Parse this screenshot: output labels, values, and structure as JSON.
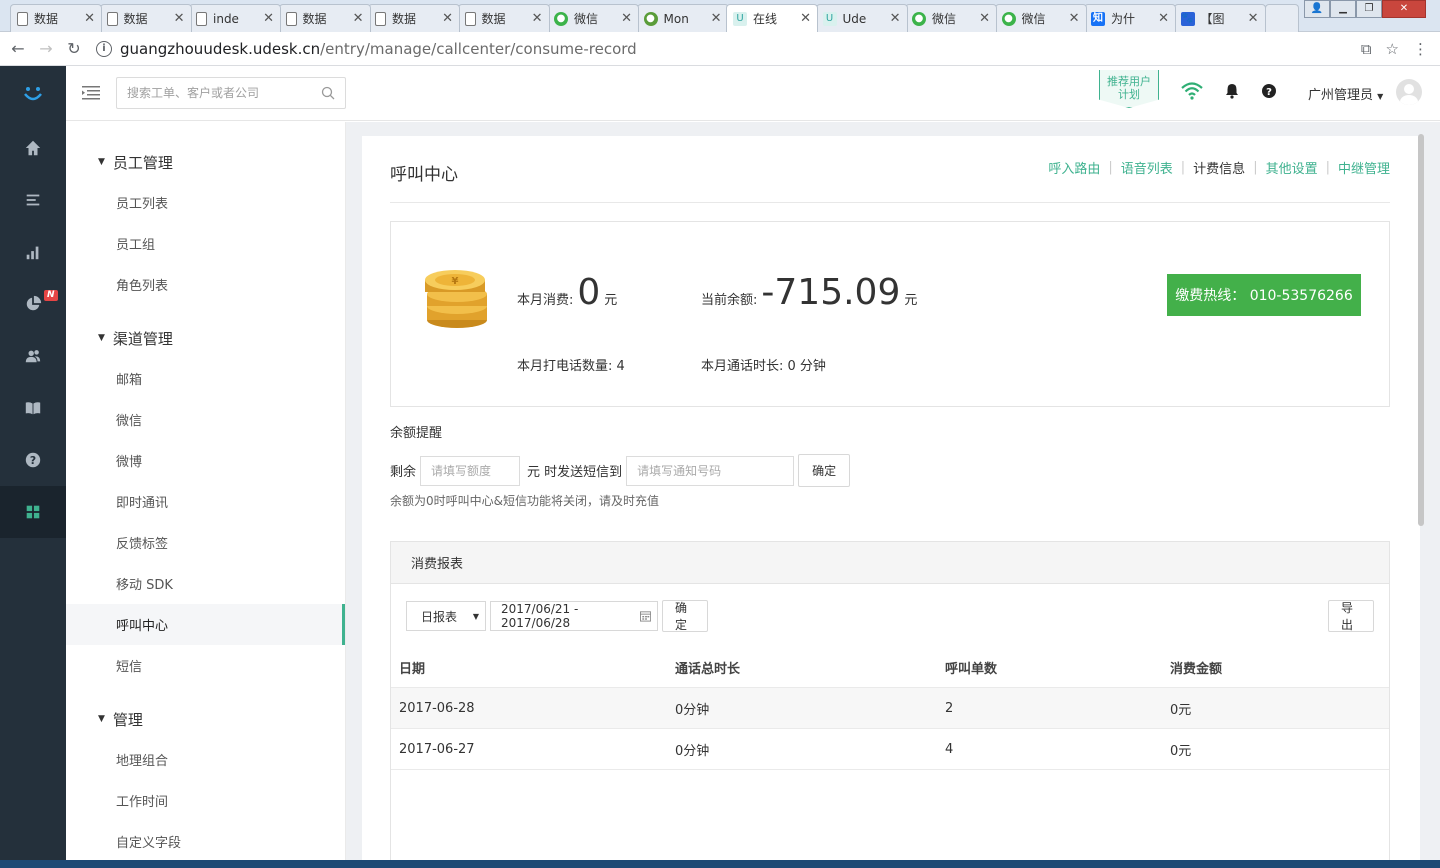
{
  "browser": {
    "tabs": [
      {
        "title": "数据",
        "icon": "doc"
      },
      {
        "title": "数据",
        "icon": "doc"
      },
      {
        "title": "inde",
        "icon": "doc"
      },
      {
        "title": "数据",
        "icon": "doc"
      },
      {
        "title": "数据",
        "icon": "doc"
      },
      {
        "title": "数据",
        "icon": "doc"
      },
      {
        "title": "微信",
        "icon": "wechat"
      },
      {
        "title": "Mon",
        "icon": "mon"
      },
      {
        "title": "在线",
        "icon": "udesk",
        "active": true
      },
      {
        "title": "Ude",
        "icon": "udesk"
      },
      {
        "title": "微信",
        "icon": "wechat"
      },
      {
        "title": "微信",
        "icon": "wechat"
      },
      {
        "title": "为什",
        "icon": "zhihu"
      },
      {
        "title": "【图",
        "icon": "baidu"
      }
    ],
    "url_host": "guangzhouudesk.udesk.cn",
    "url_path": "/entry/manage/callcenter/consume-record"
  },
  "topbar": {
    "search_placeholder": "搜索工单、客户或者公司",
    "recommend_line1": "推荐用户",
    "recommend_line2": "计划",
    "user_name": "广州管理员"
  },
  "sidebar": {
    "groups": [
      {
        "title": "员工管理",
        "items": [
          "员工列表",
          "员工组",
          "角色列表"
        ]
      },
      {
        "title": "渠道管理",
        "items": [
          "邮箱",
          "微信",
          "微博",
          "即时通讯",
          "反馈标签",
          "移动 SDK",
          "呼叫中心",
          "短信"
        ]
      },
      {
        "title": "管理",
        "items": [
          "地理组合",
          "工作时间",
          "自定义字段"
        ]
      }
    ],
    "active_item": "呼叫中心"
  },
  "page": {
    "title": "呼叫中心",
    "sub_nav": [
      "呼入路由",
      "语音列表",
      "计费信息",
      "其他设置",
      "中继管理"
    ],
    "current_sub_nav": "计费信息"
  },
  "stats": {
    "month_consume_label": "本月消费:",
    "month_consume_value": "0",
    "balance_label": "当前余额:",
    "balance_value": "-715.09",
    "unit": "元",
    "calls_label": "本月打电话数量: 4",
    "duration_label": "本月通话时长: 0 分钟",
    "hotline": "缴费热线： 010-53576266"
  },
  "remind": {
    "title": "余额提醒",
    "prefix": "剩余",
    "amount_placeholder": "请填写额度",
    "middle": "元 时发送短信到",
    "phone_placeholder": "请填写通知号码",
    "confirm": "确定",
    "tip": "余额为0时呼叫中心&短信功能将关闭，请及时充值"
  },
  "report": {
    "title": "消费报表",
    "period": "日报表",
    "date_range": "2017/06/21 - 2017/06/28",
    "confirm": "确定",
    "export": "导出",
    "columns": [
      "日期",
      "通话总时长",
      "呼叫单数",
      "消费金额"
    ],
    "rows": [
      [
        "2017-06-28",
        "0分钟",
        "2",
        "0元"
      ],
      [
        "2017-06-27",
        "0分钟",
        "4",
        "0元"
      ]
    ]
  },
  "colors": {
    "accent": "#3fb28f",
    "hotline_bg": "#43b04a",
    "rail_bg": "#24303b"
  }
}
